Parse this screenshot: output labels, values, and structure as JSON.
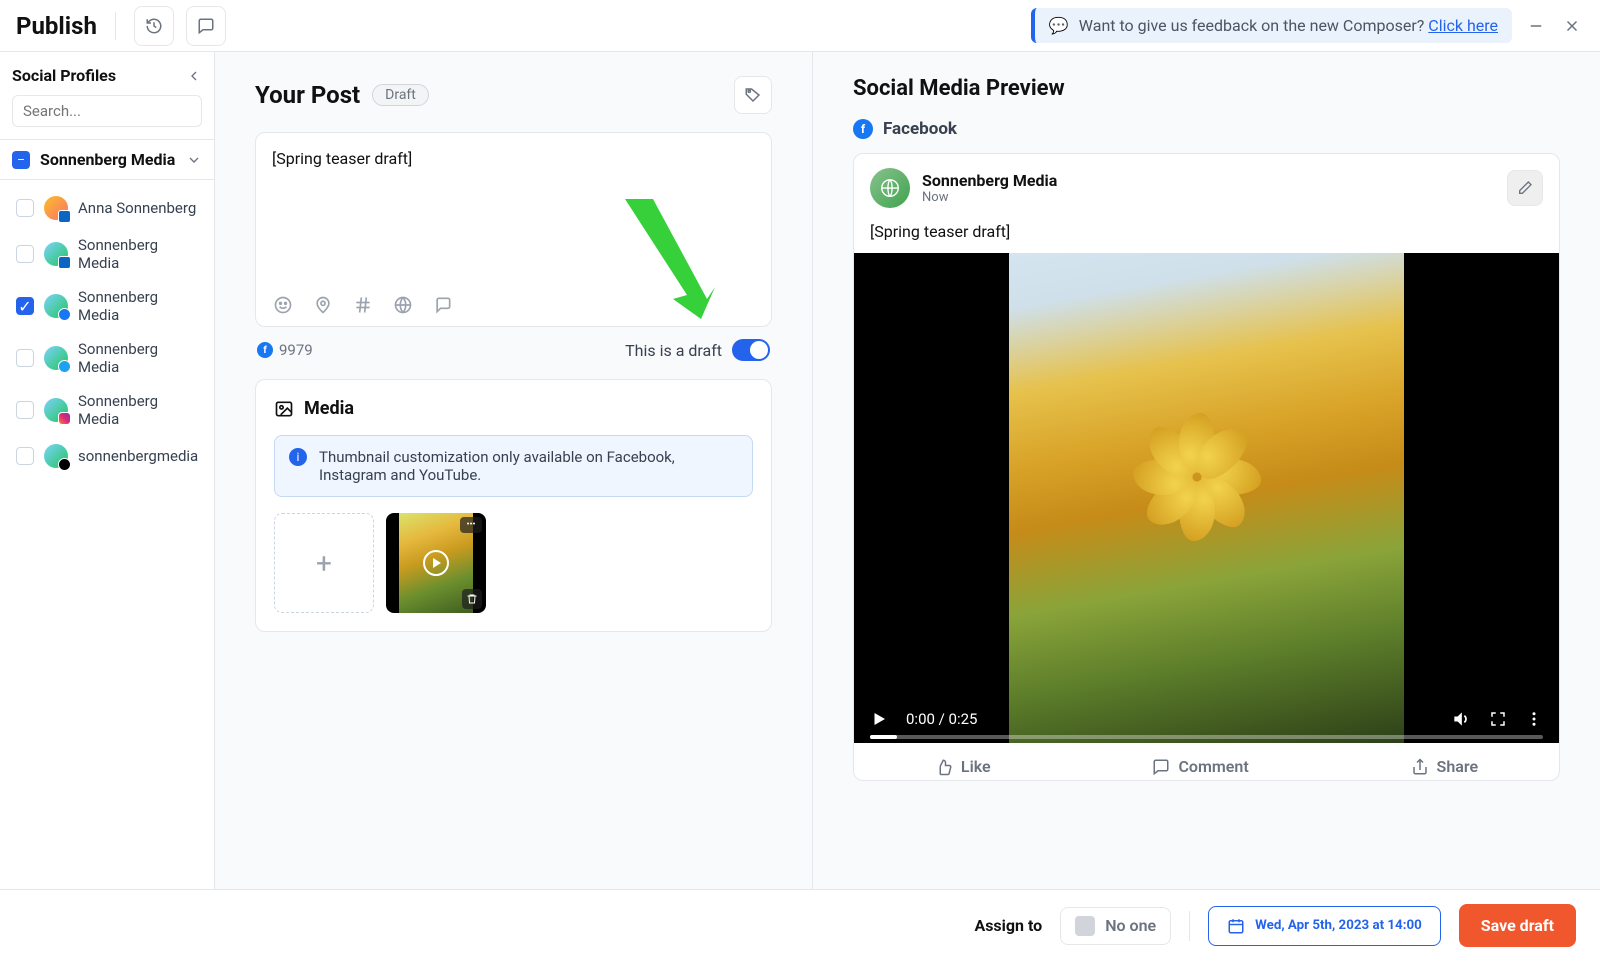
{
  "topbar": {
    "title": "Publish",
    "feedback_text": "Want to give us feedback on the new Composer? ",
    "feedback_link": "Click here"
  },
  "sidebar": {
    "title": "Social Profiles",
    "search_placeholder": "Search...",
    "group_name": "Sonnenberg Media",
    "profiles": [
      {
        "name": "Anna Sonnenberg",
        "checked": false,
        "net": "li",
        "ava": "avatar2"
      },
      {
        "name": "Sonnenberg Media",
        "checked": false,
        "net": "li",
        "ava": "avatar"
      },
      {
        "name": "Sonnenberg Media",
        "checked": true,
        "net": "fb",
        "ava": "avatar"
      },
      {
        "name": "Sonnenberg Media",
        "checked": false,
        "net": "tw",
        "ava": "avatar"
      },
      {
        "name": "Sonnenberg Media",
        "checked": false,
        "net": "ig",
        "ava": "avatar"
      },
      {
        "name": "sonnenbergmedia",
        "checked": false,
        "net": "tt",
        "ava": "avatar"
      }
    ]
  },
  "post": {
    "title": "Your Post",
    "draft_badge": "Draft",
    "body": "[Spring teaser draft]",
    "char_count": "9979",
    "draft_label": "This is a draft",
    "media_title": "Media",
    "info": "Thumbnail customization only available on Facebook, Instagram and YouTube."
  },
  "preview": {
    "title": "Social Media Preview",
    "network": "Facebook",
    "account": "Sonnenberg Media",
    "time": "Now",
    "text": "[Spring teaser draft]",
    "vtime": "0:00 / 0:25",
    "actions": {
      "like": "Like",
      "comment": "Comment",
      "share": "Share"
    }
  },
  "footer": {
    "assign_label": "Assign to",
    "assign_value": "No one",
    "schedule": "Wed, Apr 5th, 2023 at 14:00",
    "save": "Save draft"
  }
}
